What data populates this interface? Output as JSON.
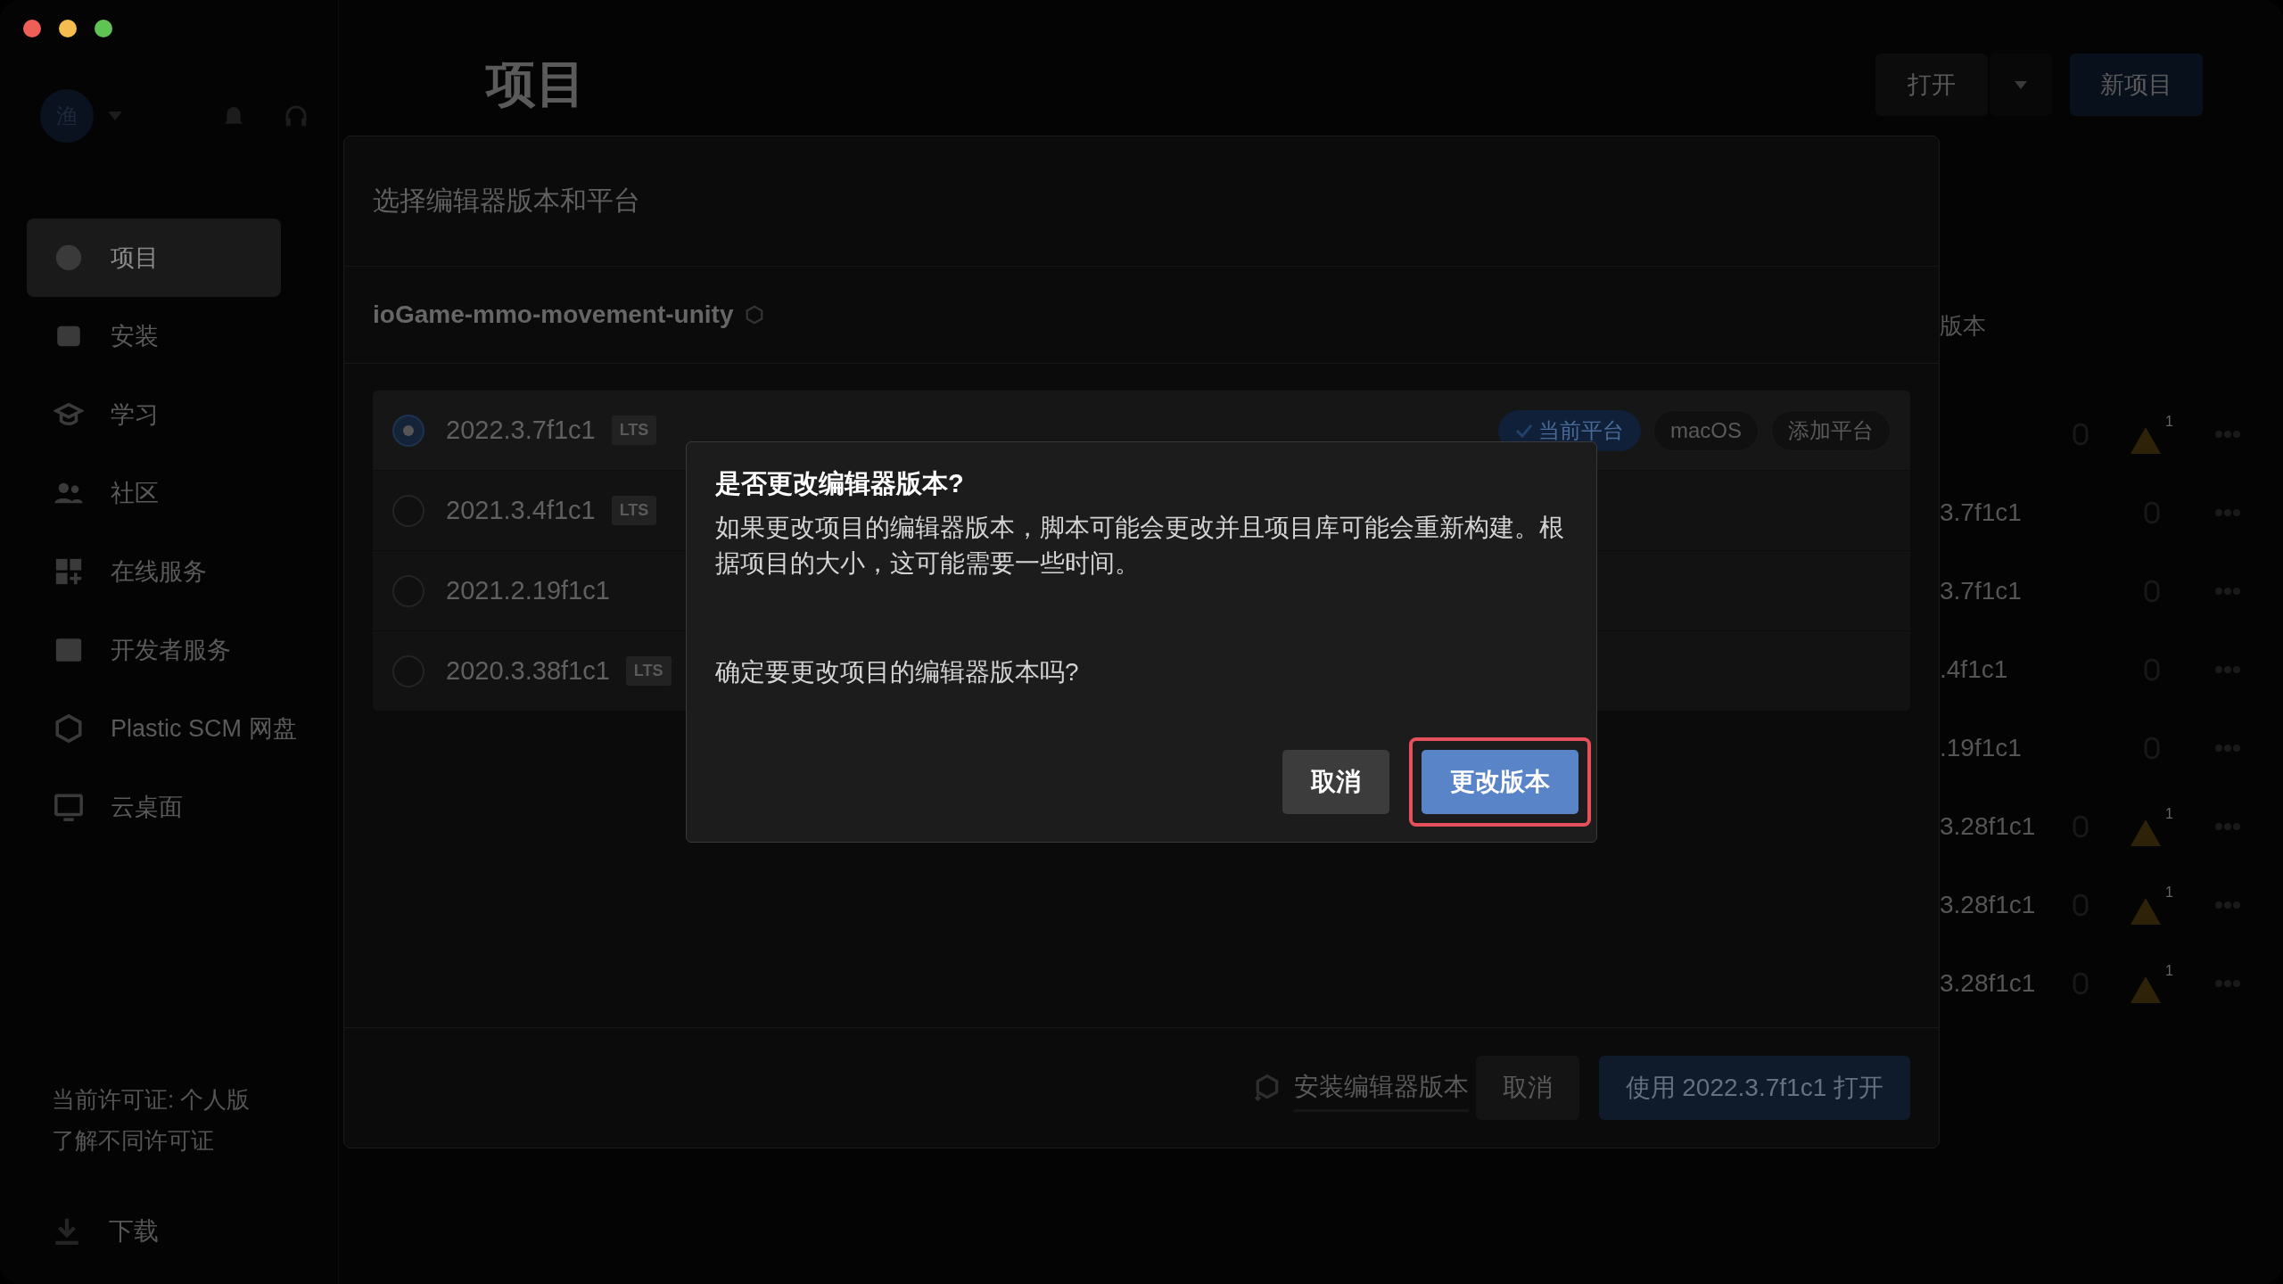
{
  "sidebar": {
    "avatar": "渔",
    "items": [
      {
        "label": "项目",
        "selected": true
      },
      {
        "label": "安装",
        "selected": false
      },
      {
        "label": "学习",
        "selected": false
      },
      {
        "label": "社区",
        "selected": false
      },
      {
        "label": "在线服务",
        "selected": false
      },
      {
        "label": "开发者服务",
        "selected": false
      },
      {
        "label": "Plastic SCM 网盘",
        "selected": false
      },
      {
        "label": "云桌面",
        "selected": false
      }
    ],
    "license": "当前许可证: 个人版",
    "license_link": "了解不同许可证",
    "download": "下载"
  },
  "header": {
    "title": "项目",
    "open_button": "打开",
    "new_button": "新项目"
  },
  "project_list": {
    "column_header": "版本",
    "rows": [
      {
        "warning": true,
        "warning_count": "1"
      },
      {
        "version": "3.7f1c1",
        "warning": false
      },
      {
        "version": "3.7f1c1",
        "warning": false
      },
      {
        "version": ".4f1c1",
        "warning": false
      },
      {
        "version": ".19f1c1",
        "warning": false
      },
      {
        "version": "3.28f1c1",
        "warning": true,
        "warning_count": "1"
      },
      {
        "version": "3.28f1c1",
        "warning": true,
        "warning_count": "1"
      },
      {
        "version": "3.28f1c1",
        "warning": true,
        "warning_count": "1"
      }
    ]
  },
  "version_dialog": {
    "title": "选择编辑器版本和平台",
    "project": "ioGame-mmo-movement-unity",
    "versions": [
      {
        "version": "2022.3.7f1c1",
        "badge": "LTS",
        "selected": true,
        "platforms": [
          {
            "label": "当前平台",
            "kind": "current"
          },
          {
            "label": "macOS",
            "kind": "chip"
          },
          {
            "label": "添加平台",
            "kind": "chip"
          }
        ]
      },
      {
        "version": "2021.3.4f1c1",
        "badge": "LTS",
        "selected": false
      },
      {
        "version": "2021.2.19f1c1",
        "selected": false
      },
      {
        "version": "2020.3.38f1c1",
        "badge": "LTS",
        "selected": false
      }
    ],
    "install_link": "安装编辑器版本",
    "cancel": "取消",
    "open": "使用 2022.3.7f1c1 打开"
  },
  "confirm_dialog": {
    "title": "是否更改编辑器版本?",
    "message": "如果更改项目的编辑器版本，脚本可能会更改并且项目库可能会重新构建。根据项目的大小，这可能需要一些时间。",
    "question": "确定要更改项目的编辑器版本吗?",
    "buttons": [
      {
        "label": "取消",
        "kind": "secondary",
        "highlighted": false
      },
      {
        "label": "更改版本",
        "kind": "primary",
        "highlighted": true
      }
    ]
  }
}
